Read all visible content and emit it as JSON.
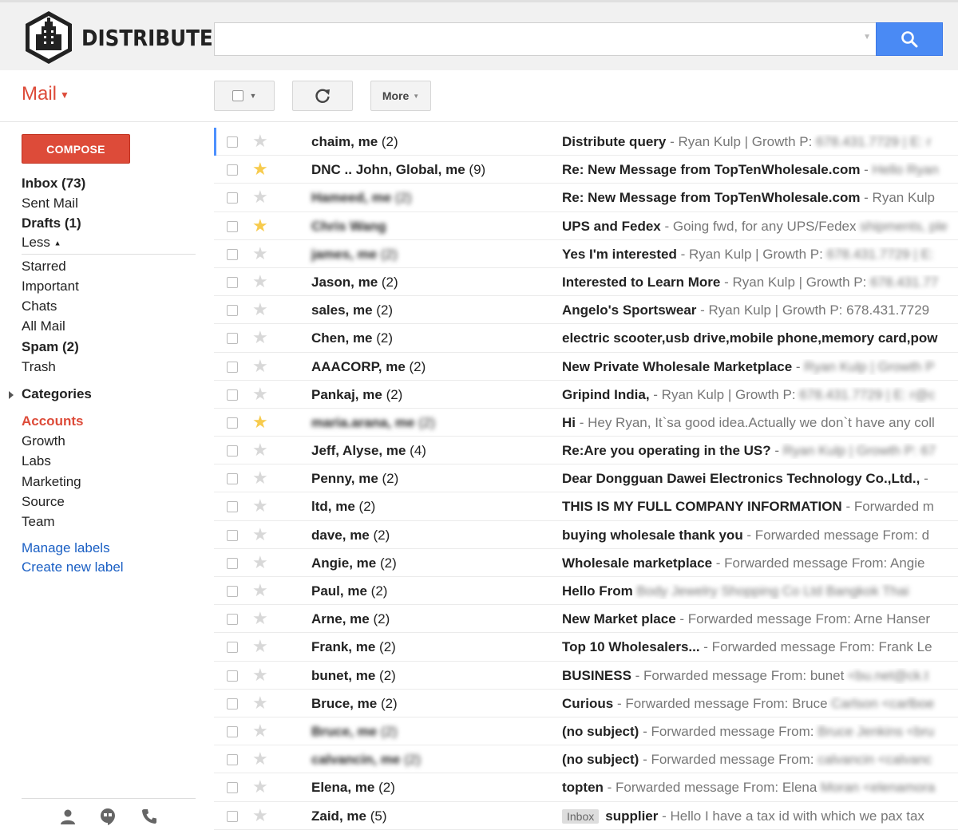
{
  "brand": {
    "name": "DISTRIBUTE"
  },
  "search": {
    "placeholder": ""
  },
  "toolbar": {
    "app_label": "Mail",
    "more_label": "More"
  },
  "sidebar": {
    "compose_label": "COMPOSE",
    "items": [
      {
        "label": "Inbox (73)",
        "bold": true
      },
      {
        "label": "Sent Mail",
        "bold": false
      },
      {
        "label": "Drafts (1)",
        "bold": true
      },
      {
        "label": "Less",
        "bold": false
      }
    ],
    "items2": [
      {
        "label": "Starred",
        "bold": false
      },
      {
        "label": "Important",
        "bold": false
      },
      {
        "label": "Chats",
        "bold": false
      },
      {
        "label": "All Mail",
        "bold": false
      },
      {
        "label": "Spam (2)",
        "bold": true
      },
      {
        "label": "Trash",
        "bold": false
      }
    ],
    "categories_label": "Categories",
    "labels": [
      {
        "label": "Accounts",
        "active": true
      },
      {
        "label": "Growth",
        "active": false
      },
      {
        "label": "Labs",
        "active": false
      },
      {
        "label": "Marketing",
        "active": false
      },
      {
        "label": "Source",
        "active": false
      },
      {
        "label": "Team",
        "active": false
      }
    ],
    "manage_labels": "Manage labels",
    "create_label": "Create new label"
  },
  "emails": [
    {
      "sender": "chaim, me",
      "count": "(2)",
      "starred": false,
      "subject": "Distribute query",
      "snippet": " - Ryan Kulp | Growth P: ",
      "blurred_tail": "678.431.7729 | E: r",
      "blur_sender": false
    },
    {
      "sender": "DNC .. John, Global, me",
      "count": "(9)",
      "starred": true,
      "subject": "Re: New Message from TopTenWholesale.com",
      "snippet": " - ",
      "blurred_tail": "Hello Ryan",
      "blur_sender": false
    },
    {
      "sender": "Hameed, me",
      "count": "(2)",
      "starred": false,
      "subject": "Re: New Message from TopTenWholesale.com",
      "snippet": " - Ryan Kulp",
      "blurred_tail": "",
      "blur_sender": true
    },
    {
      "sender": "Chris Wang",
      "count": "",
      "starred": true,
      "subject": "UPS and Fedex",
      "snippet": " - Going fwd, for any UPS/Fedex ",
      "blurred_tail": "shipments, ple",
      "blur_sender": true
    },
    {
      "sender": "james, me",
      "count": "(2)",
      "starred": false,
      "subject": "Yes I'm interested",
      "snippet": " - Ryan Kulp | Growth P: ",
      "blurred_tail": "678.431.7729 | E:",
      "blur_sender": true
    },
    {
      "sender": "Jason, me",
      "count": "(2)",
      "starred": false,
      "subject": "Interested to Learn More",
      "snippet": " - Ryan Kulp | Growth P: ",
      "blurred_tail": "678.431.77",
      "blur_sender": false
    },
    {
      "sender": "sales, me",
      "count": "(2)",
      "starred": false,
      "subject": "Angelo's Sportswear",
      "snippet": " - Ryan Kulp | Growth P: 678.431.7729",
      "blurred_tail": "",
      "blur_sender": false
    },
    {
      "sender": "Chen, me",
      "count": "(2)",
      "starred": false,
      "subject": "electric scooter,usb drive,mobile phone,memory card,pow",
      "snippet": "",
      "blurred_tail": "",
      "blur_sender": false
    },
    {
      "sender": "AAACORP, me",
      "count": "(2)",
      "starred": false,
      "subject": "New Private Wholesale Marketplace",
      "snippet": " - ",
      "blurred_tail": "Ryan Kulp | Growth P",
      "blur_sender": false
    },
    {
      "sender": "Pankaj, me",
      "count": "(2)",
      "starred": false,
      "subject": "Gripind India,",
      "snippet": " - Ryan Kulp | Growth P: ",
      "blurred_tail": "678.431.7729 | E: r@c",
      "blur_sender": false
    },
    {
      "sender": "maria.arana, me",
      "count": "(2)",
      "starred": true,
      "subject": "Hi",
      "snippet": " - Hey Ryan, It`sa good idea.Actually we don`t have any coll",
      "blurred_tail": "",
      "blur_sender": true
    },
    {
      "sender": "Jeff, Alyse, me",
      "count": "(4)",
      "starred": false,
      "subject": "Re:Are you operating in the US?",
      "snippet": " - ",
      "blurred_tail": "Ryan Kulp | Growth P: 67",
      "blur_sender": false
    },
    {
      "sender": "Penny, me",
      "count": "(2)",
      "starred": false,
      "subject": "Dear Dongguan Dawei Electronics Technology Co.,Ltd.,",
      "snippet": " -",
      "blurred_tail": "",
      "blur_sender": false
    },
    {
      "sender": "ltd, me",
      "count": "(2)",
      "starred": false,
      "subject": "THIS IS MY FULL COMPANY INFORMATION",
      "snippet": " -  Forwarded m",
      "blurred_tail": "",
      "blur_sender": false
    },
    {
      "sender": "dave, me",
      "count": "(2)",
      "starred": false,
      "subject": "buying wholesale thank you",
      "snippet": " -  Forwarded message From: d",
      "blurred_tail": "",
      "blur_sender": false
    },
    {
      "sender": "Angie, me",
      "count": "(2)",
      "starred": false,
      "subject": "Wholesale marketplace",
      "snippet": " -  Forwarded message From: Angie",
      "blurred_tail": "",
      "blur_sender": false
    },
    {
      "sender": "Paul, me",
      "count": "(2)",
      "starred": false,
      "subject": "Hello From ",
      "snippet": "",
      "blurred_tail": "Body Jewelry Shopping Co Ltd Bangkok Thai",
      "blur_sender": false
    },
    {
      "sender": "Arne, me",
      "count": "(2)",
      "starred": false,
      "subject": "New Market place",
      "snippet": " -  Forwarded message From: Arne Hanser",
      "blurred_tail": "",
      "blur_sender": false
    },
    {
      "sender": "Frank, me",
      "count": "(2)",
      "starred": false,
      "subject": "Top 10 Wholesalers...",
      "snippet": " -  Forwarded message From: Frank Le",
      "blurred_tail": "",
      "blur_sender": false
    },
    {
      "sender": "bunet, me",
      "count": "(2)",
      "starred": false,
      "subject": "BUSINESS",
      "snippet": " -  Forwarded message From: bunet ",
      "blurred_tail": "<bu.net@ck.t",
      "blur_sender": false
    },
    {
      "sender": "Bruce, me",
      "count": "(2)",
      "starred": false,
      "subject": "Curious",
      "snippet": " -  Forwarded message From: Bruce ",
      "blurred_tail": "Carlson <carlboe",
      "blur_sender": false
    },
    {
      "sender": "Bruce, me",
      "count": "(2)",
      "starred": false,
      "subject": "(no subject)",
      "snippet": " -  Forwarded message From: ",
      "blurred_tail": "Bruce Jenkins <bru",
      "blur_sender": true
    },
    {
      "sender": "calvancin, me",
      "count": "(2)",
      "starred": false,
      "subject": "(no subject)",
      "snippet": " -  Forwarded message From: ",
      "blurred_tail": "calvancin <calvanc",
      "blur_sender": true
    },
    {
      "sender": "Elena, me",
      "count": "(2)",
      "starred": false,
      "subject": "topten",
      "snippet": " -  Forwarded message From: Elena ",
      "blurred_tail": "Moran <elenamora",
      "blur_sender": false
    },
    {
      "sender": "Zaid, me",
      "count": "(5)",
      "starred": false,
      "label": "Inbox",
      "subject": "supplier",
      "snippet": " - Hello I have a tax id with which we pax tax",
      "blurred_tail": "",
      "blur_sender": false
    }
  ],
  "colors": {
    "accent_red": "#dd4b39",
    "search_blue": "#4a8af4",
    "link_blue": "#1a5fc4",
    "star_yellow": "#f7cb4d"
  },
  "icons": {
    "search": "search-icon",
    "refresh": "refresh-icon",
    "star": "star-icon",
    "contacts": "person-icon",
    "hangouts": "hangouts-icon",
    "phone": "phone-icon"
  }
}
